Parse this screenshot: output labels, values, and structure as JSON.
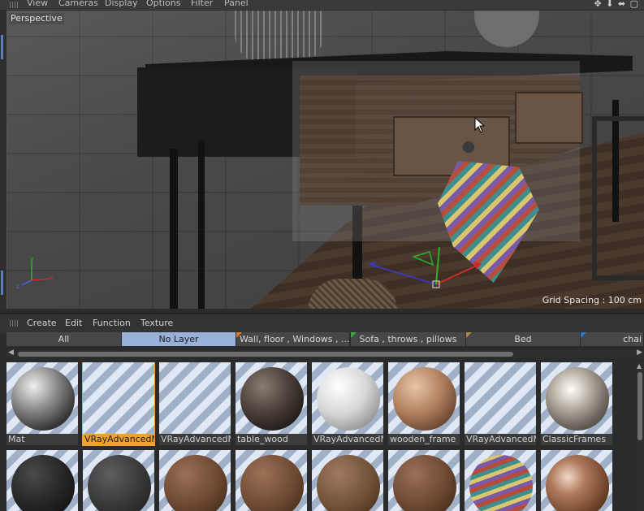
{
  "viewport": {
    "menu": [
      "View",
      "Cameras",
      "Display",
      "Options",
      "Filter",
      "Panel"
    ],
    "label": "Perspective",
    "grid_spacing": "Grid Spacing : 100 cm",
    "nav_icons": "✥ ⬇ ⬌ ▢"
  },
  "material_manager": {
    "menu": [
      "Create",
      "Edit",
      "Function",
      "Texture"
    ],
    "layer_tabs": [
      {
        "label": "All",
        "active": false
      },
      {
        "label": "No Layer",
        "active": true
      },
      {
        "label": "Wall, floor , Windows , ...",
        "flag": "#e07a2a"
      },
      {
        "label": "Sofa , throws , pillows",
        "flag": "#3aa845"
      },
      {
        "label": "Bed",
        "flag": "#b08a30"
      },
      {
        "label": "chai",
        "flag": "#2a7ad8"
      }
    ],
    "materials_row1": [
      {
        "name": "Mat",
        "style": "marble"
      },
      {
        "name": "VRayAdvancedM",
        "style": "empty",
        "selected": true
      },
      {
        "name": "VRayAdvancedM",
        "style": "empty"
      },
      {
        "name": "table_wood",
        "style": "darkwood"
      },
      {
        "name": "VRayAdvancedM",
        "style": "white"
      },
      {
        "name": "wooden_frame",
        "style": "wood"
      },
      {
        "name": "VRayAdvancedM",
        "style": "empty"
      },
      {
        "name": "ClassicFrames",
        "style": "chrome"
      }
    ],
    "materials_row2": [
      {
        "style": "black"
      },
      {
        "style": "fabric"
      },
      {
        "style": "brown"
      },
      {
        "style": "brown2"
      },
      {
        "style": "brown3"
      },
      {
        "style": "brown"
      },
      {
        "style": "zigzag"
      },
      {
        "style": "wood2"
      }
    ]
  }
}
